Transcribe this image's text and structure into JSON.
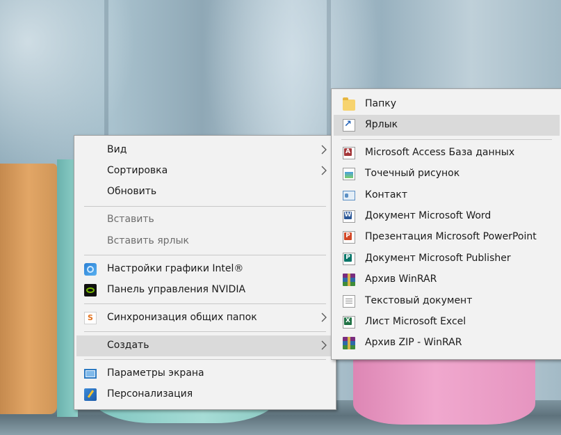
{
  "context_menu": {
    "items": [
      {
        "label": "Вид",
        "submenu": true,
        "enabled": true
      },
      {
        "label": "Сортировка",
        "submenu": true,
        "enabled": true
      },
      {
        "label": "Обновить",
        "submenu": false,
        "enabled": true
      },
      {
        "label": "Вставить",
        "submenu": false,
        "enabled": false
      },
      {
        "label": "Вставить ярлык",
        "submenu": false,
        "enabled": false
      },
      {
        "label": "Настройки графики Intel®",
        "icon": "intel-graphics-icon",
        "enabled": true
      },
      {
        "label": "Панель управления NVIDIA",
        "icon": "nvidia-icon",
        "enabled": true
      },
      {
        "label": "Синхронизация общих папок",
        "icon": "sync-folders-icon",
        "submenu": true,
        "enabled": true
      },
      {
        "label": "Создать",
        "submenu": true,
        "enabled": true,
        "highlighted": true
      },
      {
        "label": "Параметры экрана",
        "icon": "display-settings-icon",
        "enabled": true
      },
      {
        "label": "Персонализация",
        "icon": "personalization-icon",
        "enabled": true
      }
    ]
  },
  "create_submenu": {
    "items": [
      {
        "label": "Папку",
        "icon": "folder-icon"
      },
      {
        "label": "Ярлык",
        "icon": "shortcut-icon",
        "highlighted": true
      },
      {
        "label": "Microsoft Access База данных",
        "icon": "access-database-icon"
      },
      {
        "label": "Точечный рисунок",
        "icon": "bitmap-image-icon"
      },
      {
        "label": "Контакт",
        "icon": "contact-icon"
      },
      {
        "label": "Документ Microsoft Word",
        "icon": "word-document-icon"
      },
      {
        "label": "Презентация Microsoft PowerPoint",
        "icon": "powerpoint-presentation-icon"
      },
      {
        "label": "Документ Microsoft Publisher",
        "icon": "publisher-document-icon"
      },
      {
        "label": "Архив WinRAR",
        "icon": "winrar-archive-icon"
      },
      {
        "label": "Текстовый документ",
        "icon": "text-document-icon"
      },
      {
        "label": "Лист Microsoft Excel",
        "icon": "excel-sheet-icon"
      },
      {
        "label": "Архив ZIP - WinRAR",
        "icon": "zip-archive-icon"
      }
    ]
  },
  "colors": {
    "menu_background": "#f2f2f2",
    "highlight": "#dadada",
    "disabled_text": "#6d6d6d",
    "separator": "#c8c8c8"
  }
}
